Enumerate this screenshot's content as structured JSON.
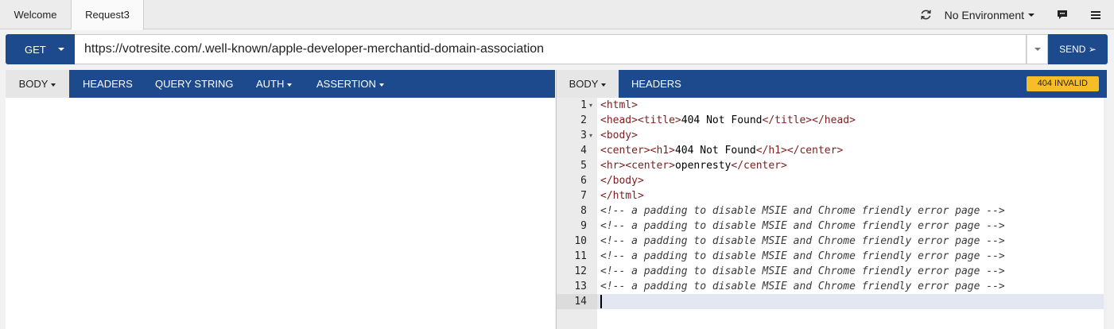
{
  "tabs": [
    {
      "label": "Welcome",
      "active": false
    },
    {
      "label": "Request3",
      "active": true
    }
  ],
  "toolbar": {
    "environment": "No Environment",
    "icons": [
      "refresh-icon",
      "chat-icon",
      "menu-icon"
    ]
  },
  "request": {
    "method": "GET",
    "url": "https://votresite.com/.well-known/apple-developer-merchantid-domain-association",
    "send_label": "SEND ➢"
  },
  "request_tabs": [
    {
      "label": "BODY",
      "dropdown": true,
      "active": true
    },
    {
      "label": "HEADERS",
      "dropdown": false,
      "active": false
    },
    {
      "label": "QUERY STRING",
      "dropdown": false,
      "active": false
    },
    {
      "label": "AUTH",
      "dropdown": true,
      "active": false
    },
    {
      "label": "ASSERTION",
      "dropdown": true,
      "active": false
    }
  ],
  "response_tabs": [
    {
      "label": "BODY",
      "dropdown": true,
      "active": true
    },
    {
      "label": "HEADERS",
      "dropdown": false,
      "active": false
    }
  ],
  "response": {
    "status_badge": "404 INVALID",
    "status_color": "#f6bd29",
    "lines": [
      {
        "n": "1",
        "fold": true,
        "text": "<html>"
      },
      {
        "n": "2",
        "fold": false,
        "text": "<head><title>404 Not Found</title></head>"
      },
      {
        "n": "3",
        "fold": true,
        "text": "<body>"
      },
      {
        "n": "4",
        "fold": false,
        "text": "<center><h1>404 Not Found</h1></center>"
      },
      {
        "n": "5",
        "fold": false,
        "text": "<hr><center>openresty</center>"
      },
      {
        "n": "6",
        "fold": false,
        "text": "</body>"
      },
      {
        "n": "7",
        "fold": false,
        "text": "</html>"
      },
      {
        "n": "8",
        "fold": false,
        "text": "<!-- a padding to disable MSIE and Chrome friendly error page -->"
      },
      {
        "n": "9",
        "fold": false,
        "text": "<!-- a padding to disable MSIE and Chrome friendly error page -->"
      },
      {
        "n": "10",
        "fold": false,
        "text": "<!-- a padding to disable MSIE and Chrome friendly error page -->"
      },
      {
        "n": "11",
        "fold": false,
        "text": "<!-- a padding to disable MSIE and Chrome friendly error page -->"
      },
      {
        "n": "12",
        "fold": false,
        "text": "<!-- a padding to disable MSIE and Chrome friendly error page -->"
      },
      {
        "n": "13",
        "fold": false,
        "text": "<!-- a padding to disable MSIE and Chrome friendly error page -->"
      },
      {
        "n": "14",
        "fold": false,
        "text": ""
      }
    ],
    "active_line": 14
  },
  "colors": {
    "primary": "#1d4a8c",
    "tag": "#7a1f1f",
    "active_line": "#e3e7f1"
  }
}
